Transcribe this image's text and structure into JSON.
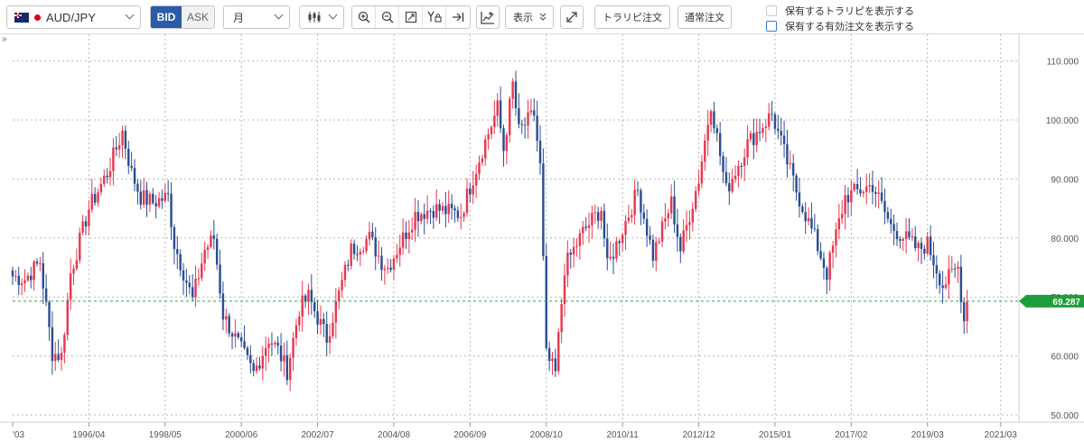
{
  "toolbar": {
    "pair": "AUD/JPY",
    "bid_label": "BID",
    "ask_label": "ASK",
    "period": "月",
    "display_label": "表示",
    "trap_button": "トラリピ注文",
    "normal_button": "通常注文",
    "check1_label": "保有するトラリピを表示する",
    "check2_label": "保有する有効注文を表示する",
    "icons": [
      "candlestick-icon",
      "zoom-in-icon",
      "zoom-out-icon",
      "fit-icon",
      "y-lock-icon",
      "jump-latest-icon",
      "indicator-icon",
      "expand-icon"
    ]
  },
  "colors": {
    "up": "#e8384f",
    "down": "#2b4d92",
    "price_line": "#2fa84f",
    "grid": "#b8b8b8"
  },
  "chart_data": {
    "type": "candlestick",
    "ylim": [
      50,
      113
    ],
    "yticks": [
      "110.000",
      "100.000",
      "90.000",
      "80.000",
      "70.000",
      "60.000",
      "50.000"
    ],
    "xticks": [
      "'03",
      "1996/04",
      "1998/05",
      "2000/06",
      "2002/07",
      "2004/08",
      "2006/09",
      "2008/10",
      "2010/11",
      "2012/12",
      "2015/01",
      "2017/02",
      "2019/03",
      "2021/03"
    ],
    "current_price": 69.287,
    "current_price_label": "69.287",
    "x_start": "1994/03",
    "x_end": "2021/09",
    "anchors": [
      [
        "1994/03",
        73.5
      ],
      [
        "1994/07",
        73.0
      ],
      [
        "1994/12",
        76.0
      ],
      [
        "1995/04",
        60.5
      ],
      [
        "1995/07",
        60.0
      ],
      [
        "1995/10",
        74.0
      ],
      [
        "1996/04",
        85.0
      ],
      [
        "1996/10",
        91.0
      ],
      [
        "1997/03",
        98.0
      ],
      [
        "1997/06",
        91.0
      ],
      [
        "1997/09",
        87.0
      ],
      [
        "1998/01",
        86.0
      ],
      [
        "1998/06",
        87.0
      ],
      [
        "1998/08",
        79.0
      ],
      [
        "1999/02",
        69.5
      ],
      [
        "1999/06",
        78.0
      ],
      [
        "1999/09",
        80.0
      ],
      [
        "1999/12",
        67.0
      ],
      [
        "2000/06",
        61.0
      ],
      [
        "2000/10",
        57.0
      ],
      [
        "2001/03",
        63.0
      ],
      [
        "2001/06",
        61.0
      ],
      [
        "2001/09",
        57.5
      ],
      [
        "2002/01",
        68.0
      ],
      [
        "2002/04",
        70.0
      ],
      [
        "2002/10",
        63.0
      ],
      [
        "2003/06",
        78.0
      ],
      [
        "2003/12",
        80.0
      ],
      [
        "2004/04",
        76.0
      ],
      [
        "2004/06",
        75.0
      ],
      [
        "2005/03",
        84.0
      ],
      [
        "2005/09",
        85.0
      ],
      [
        "2006/06",
        84.0
      ],
      [
        "2007/01",
        95.0
      ],
      [
        "2007/06",
        102.0
      ],
      [
        "2007/08",
        95.0
      ],
      [
        "2007/11",
        106.0
      ],
      [
        "2008/01",
        98.0
      ],
      [
        "2008/06",
        101.0
      ],
      [
        "2008/08",
        92.0
      ],
      [
        "2008/10",
        60.0
      ],
      [
        "2009/01",
        57.0
      ],
      [
        "2009/04",
        75.0
      ],
      [
        "2009/10",
        81.0
      ],
      [
        "2010/04",
        85.0
      ],
      [
        "2010/06",
        75.0
      ],
      [
        "2011/04",
        88.0
      ],
      [
        "2011/09",
        77.0
      ],
      [
        "2012/03",
        86.0
      ],
      [
        "2012/06",
        78.0
      ],
      [
        "2012/12",
        90.0
      ],
      [
        "2013/04",
        103.0
      ],
      [
        "2013/09",
        88.0
      ],
      [
        "2014/04",
        96.0
      ],
      [
        "2014/12",
        101.0
      ],
      [
        "2015/08",
        88.0
      ],
      [
        "2016/02",
        80.0
      ],
      [
        "2016/06",
        74.0
      ],
      [
        "2016/12",
        87.0
      ],
      [
        "2017/09",
        89.0
      ],
      [
        "2018/03",
        82.0
      ],
      [
        "2018/12",
        78.0
      ],
      [
        "2019/03",
        79.0
      ],
      [
        "2019/08",
        72.0
      ],
      [
        "2020/01",
        75.0
      ],
      [
        "2020/03",
        66.0
      ],
      [
        "2020/04",
        69.3
      ]
    ]
  }
}
